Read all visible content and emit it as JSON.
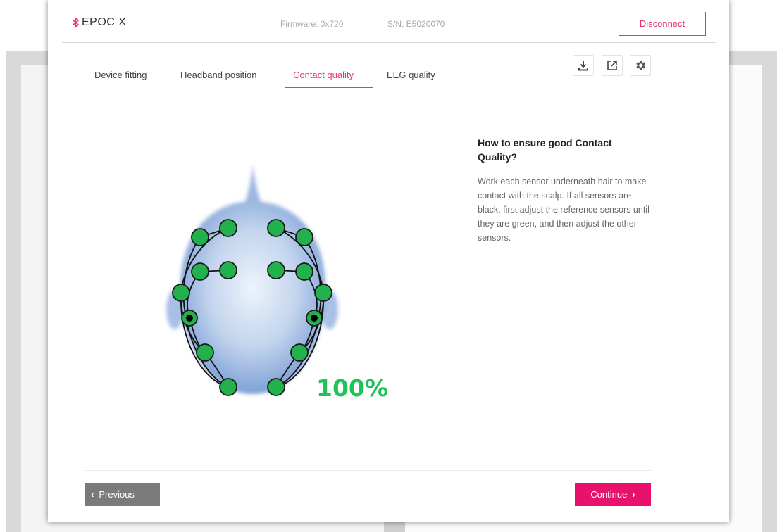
{
  "header": {
    "device_name": "EPOC X",
    "firmware": "Firmware: 0x720",
    "serial": "S/N: E5020070",
    "disconnect_label": "Disconnect"
  },
  "tabs": [
    {
      "label": "Device fitting",
      "active": false
    },
    {
      "label": "Headband position",
      "active": false
    },
    {
      "label": "Contact quality",
      "active": true
    },
    {
      "label": "EEG quality",
      "active": false
    }
  ],
  "toolbar": {
    "icons": [
      "download-icon",
      "open-external-icon",
      "gear-icon"
    ]
  },
  "contact_quality": {
    "percent_label": "100%",
    "value": 100,
    "sensor_count": 14,
    "reference_sensor_count": 2,
    "sensor_status": "green",
    "colors": {
      "good": "#22b14c",
      "reference_dot": "#000000",
      "percent": "#1fc35a"
    }
  },
  "help": {
    "title": "How to ensure good Contact Quality?",
    "body": "Work each sensor underneath hair to make contact with the scalp. If all sensors are black, first adjust the reference sensors until they are green, and then adjust the other sensors."
  },
  "footer": {
    "previous_label": "Previous",
    "continue_label": "Continue"
  },
  "colors": {
    "accent": "#e8357a",
    "continue_bg": "#e8126d",
    "previous_bg": "#7a7a7a"
  }
}
